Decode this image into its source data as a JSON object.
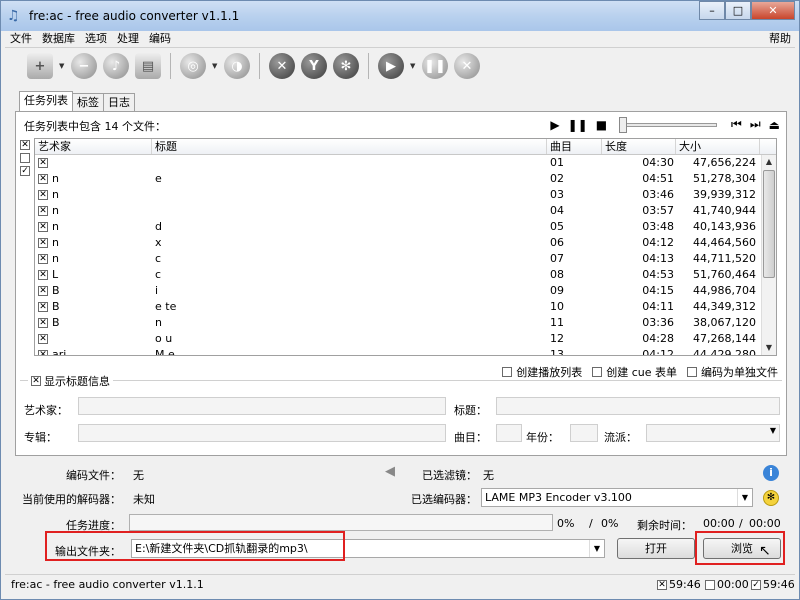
{
  "window": {
    "title": "fre:ac - free audio converter v1.1.1",
    "min": "–",
    "max": "□",
    "close": "✕"
  },
  "menu": {
    "items": [
      "文件",
      "数据库",
      "选项",
      "处理",
      "编码"
    ],
    "help": "帮助"
  },
  "tabs": [
    "任务列表",
    "标签",
    "日志"
  ],
  "joblist": {
    "count_label": "任务列表中包含 14 个文件：",
    "columns": {
      "artist": "艺术家",
      "title": "标题",
      "track": "曲目",
      "length": "长度",
      "size": "大小"
    },
    "rows": [
      {
        "artist": "",
        "title": "",
        "track": "01",
        "length": "04:30",
        "size": "47,656,224"
      },
      {
        "artist": "n",
        "title": "e",
        "track": "02",
        "length": "04:51",
        "size": "51,278,304"
      },
      {
        "artist": "n",
        "title": "",
        "track": "03",
        "length": "03:46",
        "size": "39,939,312"
      },
      {
        "artist": "n",
        "title": "",
        "track": "04",
        "length": "03:57",
        "size": "41,740,944"
      },
      {
        "artist": "n",
        "title": "d",
        "track": "05",
        "length": "03:48",
        "size": "40,143,936"
      },
      {
        "artist": "n",
        "title": "x",
        "track": "06",
        "length": "04:12",
        "size": "44,464,560"
      },
      {
        "artist": "n",
        "title": "c",
        "track": "07",
        "length": "04:13",
        "size": "44,711,520"
      },
      {
        "artist": "L",
        "title": "c",
        "track": "08",
        "length": "04:53",
        "size": "51,760,464"
      },
      {
        "artist": "B",
        "title": "i",
        "track": "09",
        "length": "04:15",
        "size": "44,986,704"
      },
      {
        "artist": "B",
        "title": "e      te",
        "track": "10",
        "length": "04:11",
        "size": "44,349,312"
      },
      {
        "artist": "B",
        "title": "n",
        "track": "11",
        "length": "03:36",
        "size": "38,067,120"
      },
      {
        "artist": "",
        "title": "o        u",
        "track": "12",
        "length": "04:28",
        "size": "47,268,144"
      },
      {
        "artist": "ari",
        "title": "M        e",
        "track": "13",
        "length": "04:12",
        "size": "44,429,280"
      }
    ],
    "options": [
      "创建播放列表",
      "创建 cue 表单",
      "编码为单独文件"
    ]
  },
  "titleinfo": {
    "legend": "显示标题信息",
    "artist": "艺术家：",
    "title": "标题：",
    "album": "专辑：",
    "track": "曲目：",
    "year": "年份：",
    "genre": "流派："
  },
  "encoder": {
    "encoding_file_label": "编码文件：",
    "encoding_file_value": "无",
    "selected_filter_label": "已选滤镜：",
    "selected_filter_value": "无",
    "decoder_label": "当前使用的解码器：",
    "decoder_value": "未知",
    "selected_encoder_label": "已选编码器：",
    "selected_encoder_value": "LAME MP3 Encoder v3.100",
    "progress_label": "任务进度：",
    "progress_pct1": "0%",
    "progress_sep": "/",
    "progress_pct2": "0%",
    "remaining_label": "剩余时间：",
    "time1": "00:00",
    "time_sep": "/",
    "time2": "00:00",
    "output_label": "输出文件夹：",
    "output_value": "E:\\新建文件夹\\CD抓轨翻录的mp3\\",
    "open_button": "打开",
    "browse_button": "浏览",
    "progress": 0
  },
  "statusbar": {
    "text": "fre:ac - free audio converter v1.1.1",
    "s1": "59:46",
    "s2": "00:00",
    "s3": "59:46"
  }
}
